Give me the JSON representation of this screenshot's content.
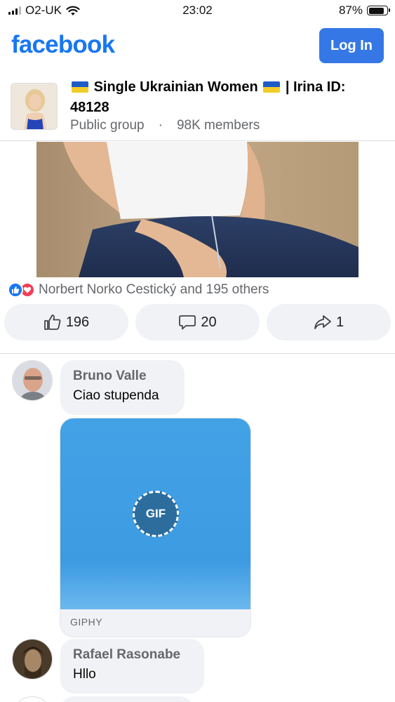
{
  "status_bar": {
    "carrier": "O2-UK",
    "time": "23:02",
    "battery": "87%",
    "battery_level": 0.87,
    "icons": [
      "signal-icon",
      "wifi-icon",
      "battery-icon"
    ]
  },
  "header": {
    "logo": "facebook",
    "login_label": "Log In",
    "accent": "#1877f2",
    "button_color": "#3578e5"
  },
  "group": {
    "title_prefix": "Single Ukrainian Women",
    "title_suffix": "| Irina ID: 48128",
    "privacy": "Public group",
    "separator": "·",
    "members": "98K members"
  },
  "post": {
    "reactions_text": "Norbert Norko Cestický and 195 others",
    "reaction_icons": [
      "like-reaction-icon",
      "love-reaction-icon"
    ],
    "like_count": "196",
    "comment_count": "20",
    "share_count": "1"
  },
  "comments": [
    {
      "author": "Bruno Valle",
      "text": "Ciao stupenda"
    },
    {
      "author": "Rafael Rasonabe",
      "text": "Hllo"
    }
  ],
  "gif": {
    "badge": "GIF",
    "source": "GIPHY",
    "color": "#43a2e6"
  }
}
